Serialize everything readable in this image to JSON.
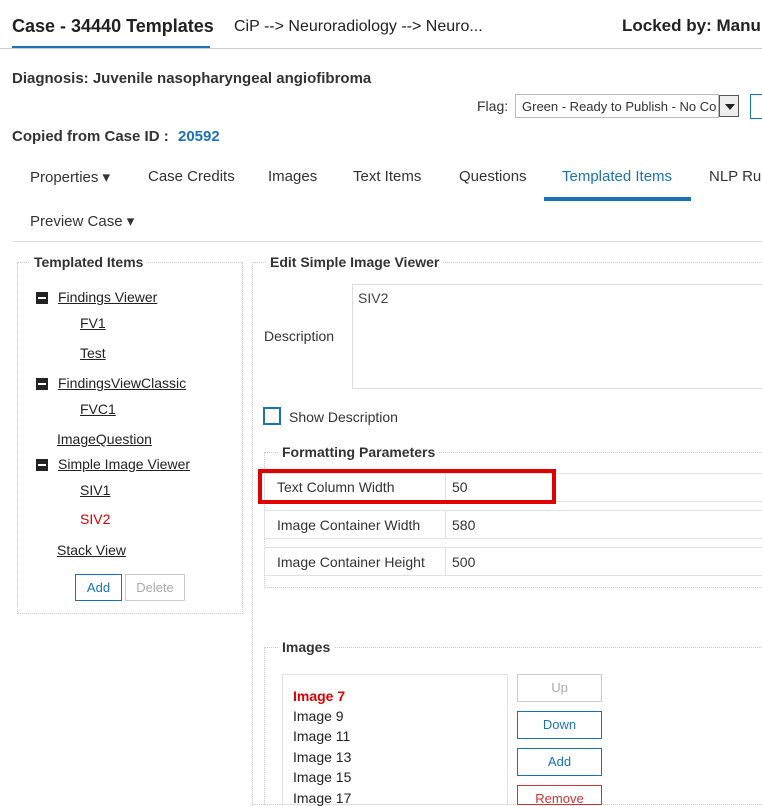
{
  "header": {
    "title": "Case - 34440 Templates",
    "breadcrumb": "CiP --> Neuroradiology --> Neuro...",
    "locked": "Locked by: Manu"
  },
  "diagnosis": "Diagnosis: Juvenile nasopharyngeal angiofibroma",
  "flag": {
    "label": "Flag:",
    "value": "Green - Ready to Publish - No Co"
  },
  "copied": {
    "label": "Copied from Case ID :",
    "case_id": "20592"
  },
  "tabs": [
    {
      "label": "Properties ▾"
    },
    {
      "label": "Case Credits"
    },
    {
      "label": "Images"
    },
    {
      "label": "Text Items"
    },
    {
      "label": "Questions"
    },
    {
      "label": "Templated Items",
      "active": true
    },
    {
      "label": "NLP Rul"
    }
  ],
  "preview": "Preview Case ▾",
  "templated": {
    "legend": "Templated Items",
    "groups": [
      {
        "label": "Findings Viewer",
        "children": [
          "FV1",
          "Test"
        ]
      },
      {
        "label": "FindingsViewClassic",
        "children": [
          "FVC1"
        ]
      },
      {
        "label": "ImageQuestion"
      },
      {
        "label": "Simple Image Viewer",
        "children": [
          "SIV1",
          "SIV2"
        ]
      },
      {
        "label": "Stack View"
      }
    ],
    "add_label": "Add",
    "delete_label": "Delete"
  },
  "edit": {
    "legend": "Edit Simple Image Viewer",
    "description_label": "Description",
    "description_value": "SIV2",
    "show_description_label": "Show Description",
    "show_description_checked": false
  },
  "formatting": {
    "legend": "Formatting Parameters",
    "rows": [
      {
        "label": "Text Column Width",
        "value": "50"
      },
      {
        "label": "Image Container Width",
        "value": "580"
      },
      {
        "label": "Image Container Height",
        "value": "500"
      }
    ]
  },
  "images": {
    "legend": "Images",
    "items": [
      "Image 7",
      "Image 9",
      "Image 11",
      "Image 13",
      "Image 15",
      "Image 17"
    ],
    "up_label": "Up",
    "down_label": "Down",
    "add_label": "Add",
    "remove_label": "Remove"
  },
  "colors": {
    "accent": "#1a73b8",
    "highlight": "#e00000",
    "selected_text": "#dd0000"
  }
}
